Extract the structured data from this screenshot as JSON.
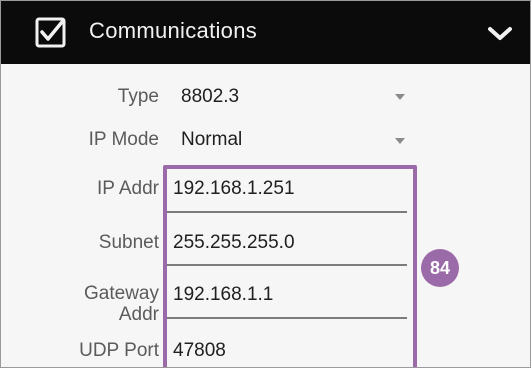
{
  "header": {
    "title": "Communications",
    "checked": true,
    "check_icon": "checkbox-checked-icon",
    "collapse_icon": "chevron-down-icon"
  },
  "fields": {
    "type": {
      "label": "Type",
      "value": "8802.3"
    },
    "ip_mode": {
      "label": "IP Mode",
      "value": "Normal"
    },
    "ip_addr": {
      "label": "IP Addr",
      "value": "192.168.1.251"
    },
    "subnet": {
      "label": "Subnet",
      "value": "255.255.255.0"
    },
    "gateway": {
      "label_line1": "Gateway",
      "label_line2": "Addr",
      "value": "192.168.1.1"
    },
    "udp_port": {
      "label": "UDP Port",
      "value": "47808"
    }
  },
  "callout": {
    "badge": "84"
  },
  "colors": {
    "header_bg": "#0b0b0b",
    "highlight": "#9b6aa8",
    "panel_bg": "#f6f6f6"
  }
}
